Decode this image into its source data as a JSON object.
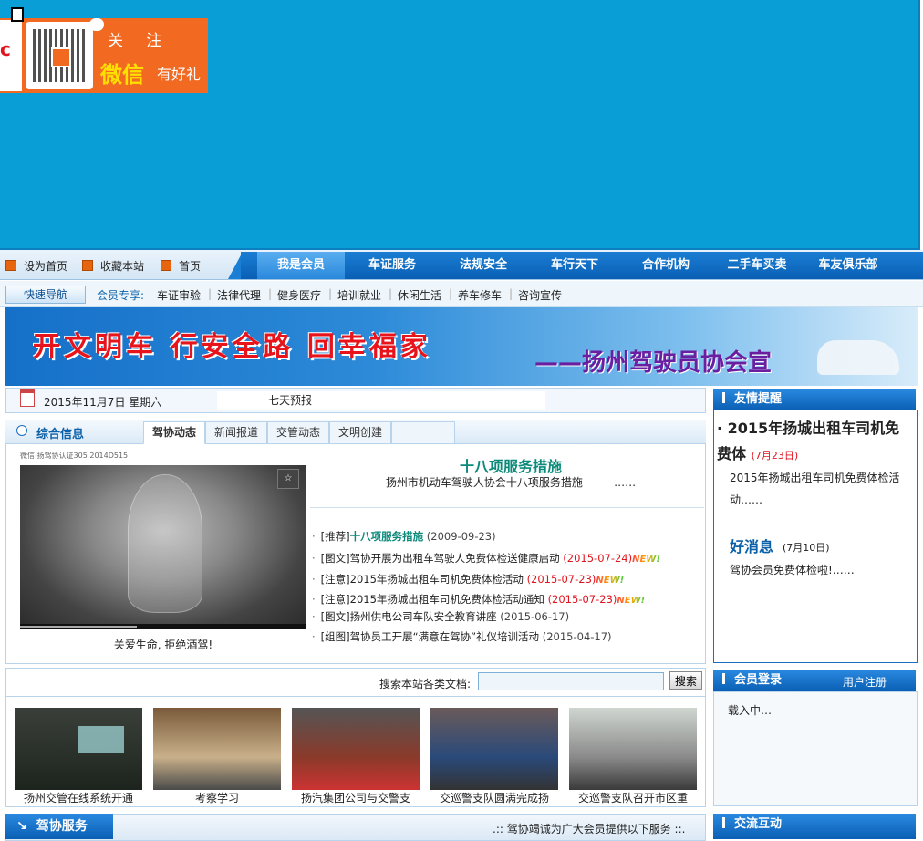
{
  "ad": {
    "guanzhu": "关 注",
    "weixin": "微信",
    "haoli": "有好礼",
    "left_mark": "c"
  },
  "quick_links": [
    "设为首页",
    "收藏本站",
    "首页"
  ],
  "main_nav": [
    "我是会员",
    "车证服务",
    "法规安全",
    "车行天下",
    "合作机构",
    "二手车买卖",
    "车友俱乐部"
  ],
  "sub_nav": {
    "button": "快速导航",
    "label": "会员专享:",
    "items": [
      "车证审验",
      "法律代理",
      "健身医疗",
      "培训就业",
      "休闲生活",
      "养车修车",
      "咨询宣传"
    ]
  },
  "banner": {
    "slogan": "开文明车  行安全路  回幸福家",
    "sub": "——扬州驾驶员协会宣"
  },
  "datebar": {
    "date": "2015年11月7日 星期六",
    "weather": "七天预报"
  },
  "info": {
    "title": "综合信息",
    "tabs": [
      "驾协动态",
      "新闻报道",
      "交管动态",
      "文明创建"
    ],
    "video_caption_top": "微信·扬驾协认证305 2014D515",
    "video_caption": "关爱生命, 拒绝酒驾!",
    "video_star": "☆",
    "feature_title": "十八项服务措施",
    "feature_desc": "扬州市机动车驾驶人协会十八项服务措施",
    "feature_more": "……",
    "news": [
      {
        "tag": "[推荐]",
        "title": "十八项服务措施",
        "date": "(2009-09-23)",
        "hl": true,
        "new": false
      },
      {
        "tag": "[图文]",
        "title": "驾协开展为出租车驾驶人免费体检送健康启动",
        "date": "(2015-07-24)",
        "hl": false,
        "new": true
      },
      {
        "tag": "[注意]",
        "title": "2015年扬城出租车司机免费体检活动",
        "date": "(2015-07-23)",
        "hl": false,
        "new": true
      },
      {
        "tag": "[注意]",
        "title": "2015年扬城出租车司机免费体检活动通知",
        "date": "(2015-07-23)",
        "hl": false,
        "new": true
      },
      {
        "tag": "[图文]",
        "title": "扬州供电公司车队安全教育讲座",
        "date": "(2015-06-17)",
        "hl": false,
        "new": false
      },
      {
        "tag": "[组图]",
        "title": "驾协员工开展“满意在驾协”礼仪培训活动",
        "date": "(2015-04-17)",
        "hl": false,
        "new": false
      }
    ],
    "new_label": "NEW!"
  },
  "remind": {
    "title": "友情提醒",
    "item1_title": "· 2015年扬城出租车司机免费体",
    "item1_date": "(7月23日)",
    "item1_body": "2015年扬城出租车司机免费体检活动……",
    "item2_title": "好消息",
    "item2_date": "(7月10日)",
    "item2_body": "驾协会员免费体检啦!……"
  },
  "login": {
    "title": "会员登录",
    "register": "用户注册",
    "loading": "载入中…"
  },
  "search": {
    "label": "搜索本站各类文档:",
    "button": "搜索",
    "value": ""
  },
  "photos": [
    {
      "caption": "扬州交管在线系统开通"
    },
    {
      "caption": "考察学习"
    },
    {
      "caption": "扬汽集团公司与交警支"
    },
    {
      "caption": "交巡警支队圆满完成扬"
    },
    {
      "caption": "交巡警支队召开市区重"
    }
  ],
  "service": {
    "title": "驾协服务",
    "tagline": ".:: 驾协竭诚为广大会员提供以下服务 ::.",
    "interact": "交流互动"
  },
  "colors": {
    "top_blue": "#0a9ed6",
    "nav_blue": "#0a5fb4",
    "accent_red": "#e0141e",
    "teal": "#0b8a7a"
  }
}
